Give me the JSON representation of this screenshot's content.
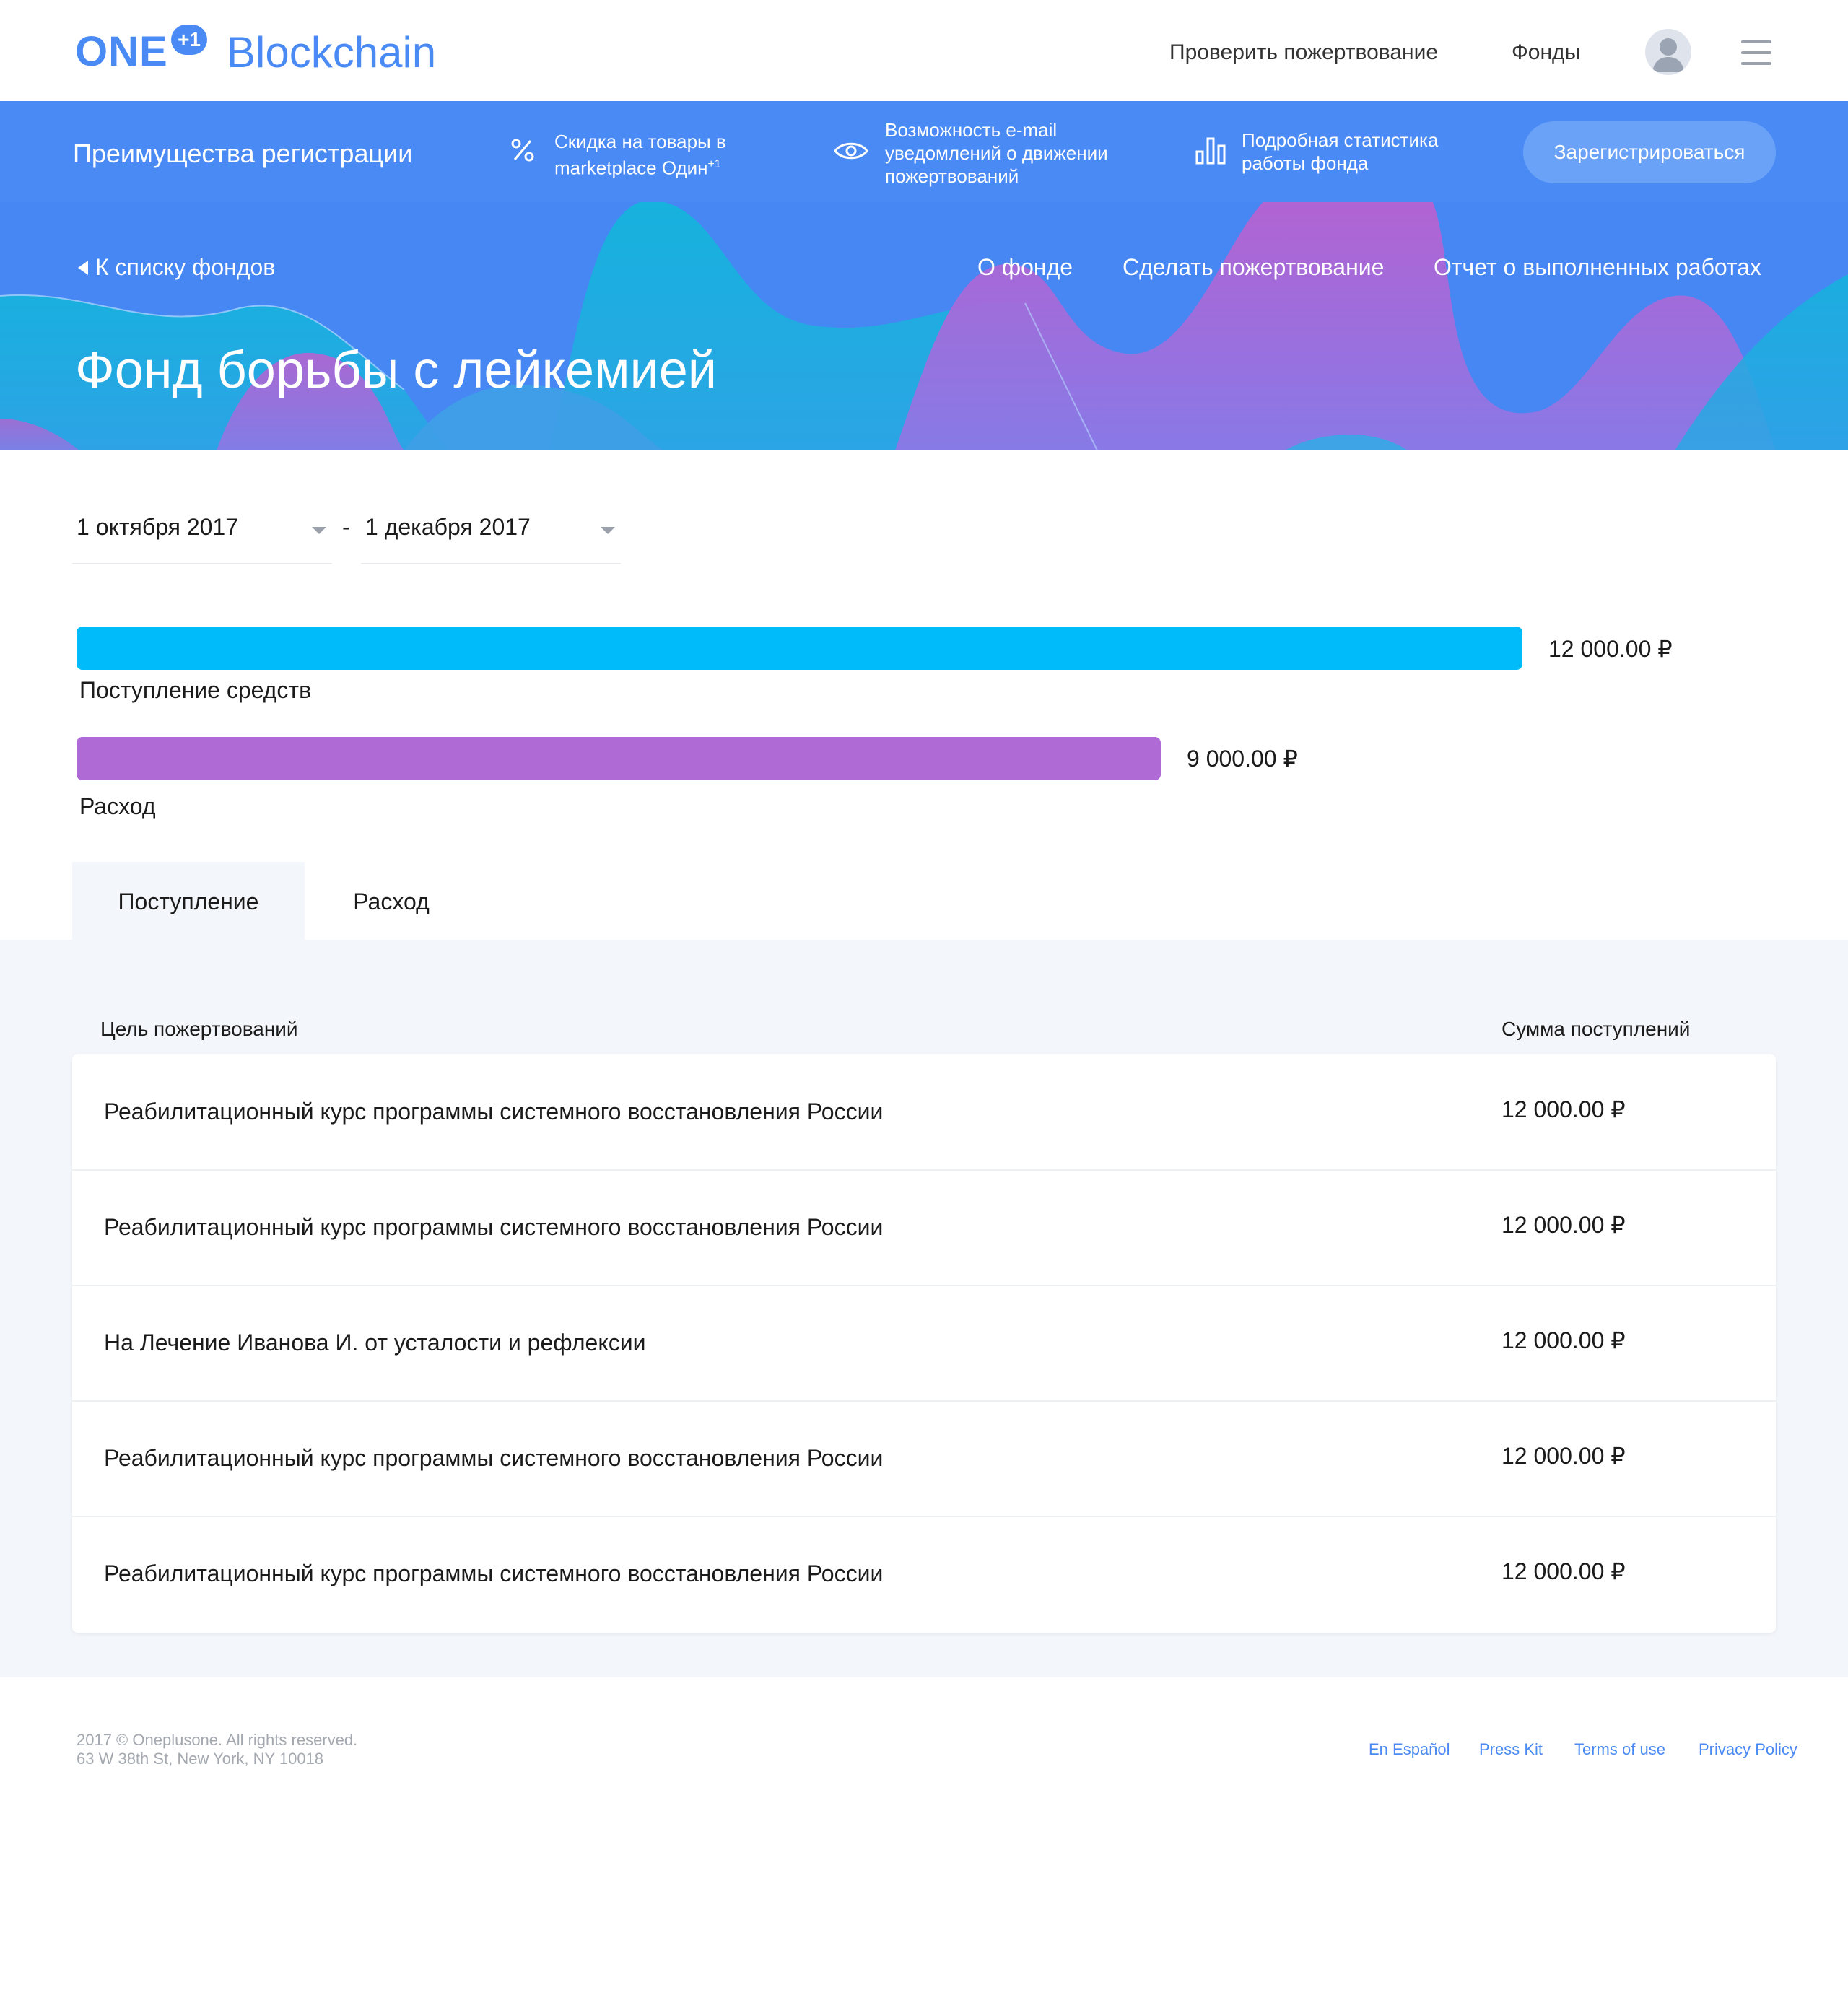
{
  "header": {
    "logo_one": "ONE",
    "logo_badge": "+1",
    "logo_word": "Blockchain",
    "nav": [
      "Проверить пожертвование",
      "Фонды"
    ]
  },
  "promo": {
    "title": "Преимущества регистрации",
    "features": [
      {
        "icon": "percent-icon",
        "text_line1": "Скидка на товары в",
        "text_line2": "marketplace Один",
        "text_sup": "+1"
      },
      {
        "icon": "eye-icon",
        "text_line1": "Возможность e-mail",
        "text_line2": "уведомлений о движении",
        "text_line3": "пожертвований"
      },
      {
        "icon": "bar-chart-icon",
        "text_line1": "Подробная статистика",
        "text_line2": "работы фонда"
      }
    ],
    "register_label": "Зарегистрироваться"
  },
  "hero": {
    "back_label": "К списку фондов",
    "nav": [
      "О фонде",
      "Сделать пожертвование",
      "Отчет о выполненных работах"
    ],
    "title": "Фонд борьбы с лейкемией"
  },
  "filters": {
    "date_from": "1 октября 2017",
    "separator": "-",
    "date_to": "1 декабря 2017"
  },
  "summary": {
    "bars": [
      {
        "label": "Поступление средств",
        "value": 12000,
        "value_text": "12 000.00 ₽",
        "color": "#00bbf9"
      },
      {
        "label": "Расход",
        "value": 9000,
        "value_text": "9 000.00 ₽",
        "color": "#b06ad6"
      }
    ],
    "max": 12000
  },
  "tabs": [
    "Поступление",
    "Расход"
  ],
  "table": {
    "columns": [
      "Цель пожертвований",
      "Сумма поступлений"
    ],
    "rows": [
      {
        "goal": "Реабилитационный курс программы системного восстановления России",
        "amount": "12 000.00 ₽"
      },
      {
        "goal": "Реабилитационный курс программы системного восстановления России",
        "amount": "12 000.00 ₽"
      },
      {
        "goal": "На Лечение Иванова И. от усталости и рефлексии",
        "amount": "12 000.00 ₽"
      },
      {
        "goal": "Реабилитационный курс программы системного восстановления России",
        "amount": "12 000.00 ₽"
      },
      {
        "goal": "Реабилитационный курс программы системного восстановления России",
        "amount": "12 000.00 ₽"
      }
    ]
  },
  "footer": {
    "copyright": "2017 © Oneplusone. All rights reserved.",
    "address": "63 W 38th St, New York, NY 10018",
    "links": [
      "En Español",
      "Press Kit",
      "Terms of use",
      "Privacy Policy"
    ]
  },
  "colors": {
    "brand": "#4a8af4",
    "income": "#00bbf9",
    "expense": "#b06ad6",
    "panel_bg": "#f3f6fa"
  }
}
